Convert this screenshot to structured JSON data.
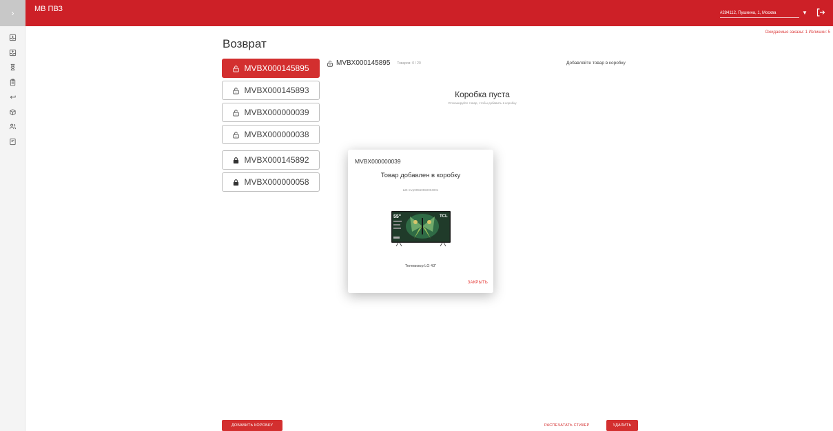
{
  "app": {
    "brand": "МВ ПВЗ",
    "address": "#284112, Пушкина, 1, Москва",
    "counters": "Ожидаемые заказы: 1   Излишки: 5"
  },
  "rail": {
    "toggle": "›",
    "icons": [
      "inbox-in-icon",
      "inbox-out-icon",
      "hourglass-icon",
      "clipboard-icon",
      "return-icon",
      "box-icon",
      "users-icon",
      "report-icon"
    ]
  },
  "page": {
    "title": "Возврат"
  },
  "boxes": [
    {
      "code": "MVBX000145895",
      "state": "open",
      "active": true
    },
    {
      "code": "MVBX000145893",
      "state": "open",
      "active": false
    },
    {
      "code": "MVBX000000039",
      "state": "open",
      "active": false
    },
    {
      "code": "MVBX000000038",
      "state": "open",
      "active": false
    },
    {
      "code": "MVBX000145892",
      "state": "closed",
      "active": false
    },
    {
      "code": "MVBX000000058",
      "state": "closed",
      "active": false
    }
  ],
  "panel": {
    "code": "MVBX000145895",
    "count": "Товаров: 0 / 20",
    "hint": "Добавляйте товар в коробку",
    "empty_title": "Коробка пуста",
    "empty_sub": "Отсканируйте товар, чтобы добавить в коробку"
  },
  "modal": {
    "box_code": "MVBX000000039",
    "title": "Товар добавлен в коробку",
    "barcode": "ШК mvp99550550004001",
    "product_name": "Телевизор LG 43\"",
    "close_label": "ЗАКРЫТЬ",
    "image": {
      "size_label": "55\"",
      "brand_label": "TCL"
    }
  },
  "actions": {
    "add_box": "ДОБАВИТЬ КОРОБКУ",
    "print_sticker": "РАСПЕЧАТАТЬ СТИКЕР",
    "delete": "УДАЛИТЬ"
  },
  "colors": {
    "accent": "#cd2027",
    "button_red": "#d32f2f"
  }
}
